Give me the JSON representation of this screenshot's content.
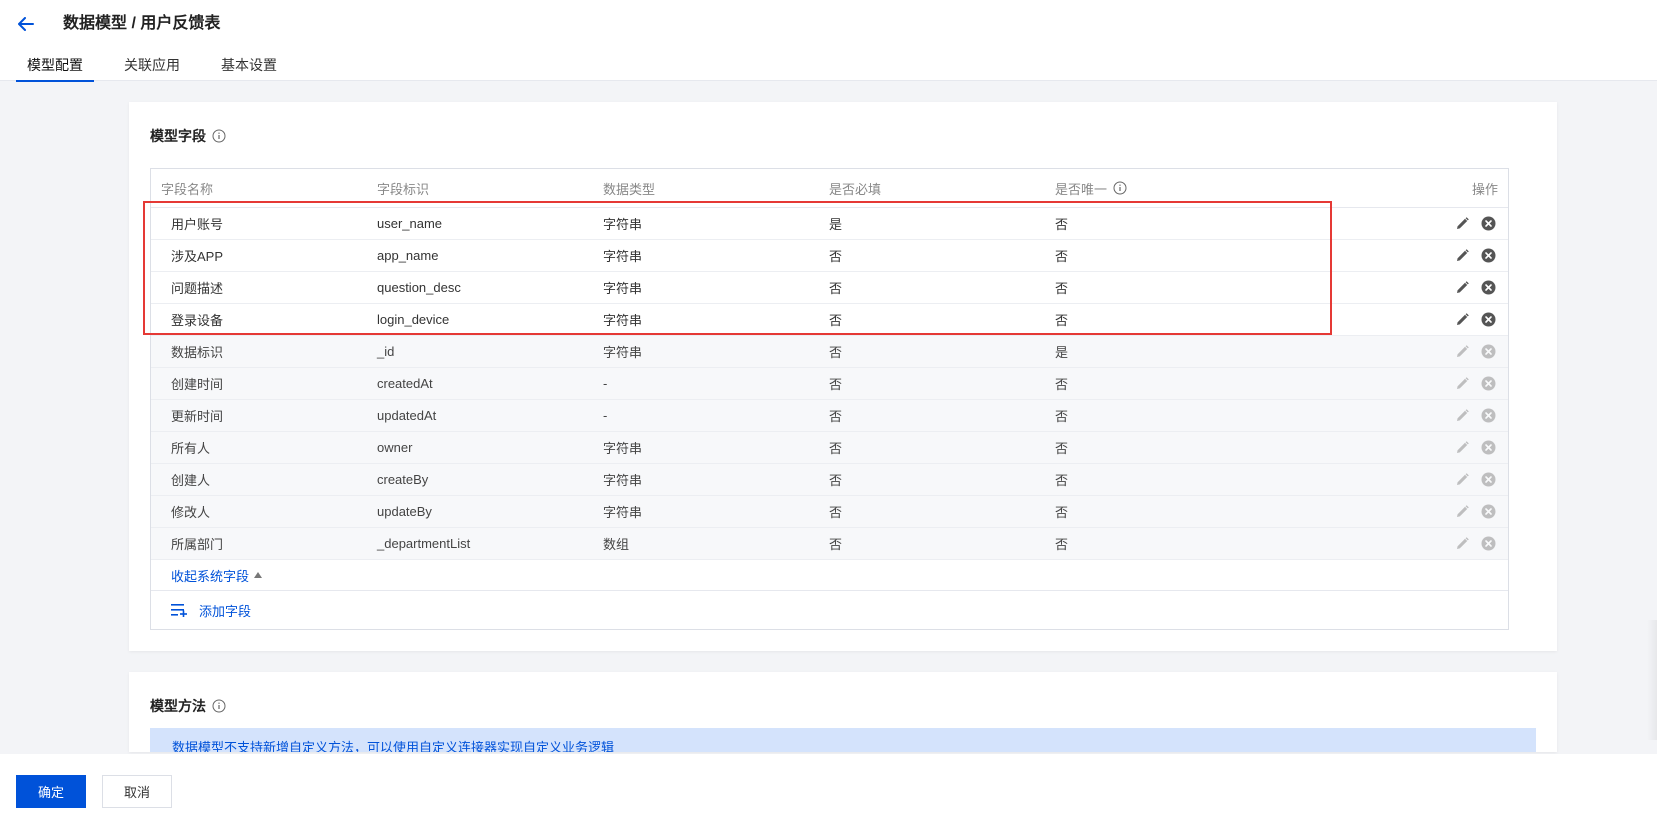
{
  "header": {
    "title": "数据模型 / 用户反馈表",
    "tabs": [
      {
        "label": "模型配置",
        "active": true
      },
      {
        "label": "关联应用",
        "active": false
      },
      {
        "label": "基本设置",
        "active": false
      }
    ]
  },
  "fields_card": {
    "title": "模型字段",
    "columns": [
      "字段名称",
      "字段标识",
      "数据类型",
      "是否必填",
      "是否唯一",
      "操作"
    ],
    "rows": [
      {
        "name": "用户账号",
        "key": "user_name",
        "type": "字符串",
        "required": "是",
        "unique": "否",
        "system": false
      },
      {
        "name": "涉及APP",
        "key": "app_name",
        "type": "字符串",
        "required": "否",
        "unique": "否",
        "system": false
      },
      {
        "name": "问题描述",
        "key": "question_desc",
        "type": "字符串",
        "required": "否",
        "unique": "否",
        "system": false
      },
      {
        "name": "登录设备",
        "key": "login_device",
        "type": "字符串",
        "required": "否",
        "unique": "否",
        "system": false
      },
      {
        "name": "数据标识",
        "key": "_id",
        "type": "字符串",
        "required": "否",
        "unique": "是",
        "system": true
      },
      {
        "name": "创建时间",
        "key": "createdAt",
        "type": "-",
        "required": "否",
        "unique": "否",
        "system": true
      },
      {
        "name": "更新时间",
        "key": "updatedAt",
        "type": "-",
        "required": "否",
        "unique": "否",
        "system": true
      },
      {
        "name": "所有人",
        "key": "owner",
        "type": "字符串",
        "required": "否",
        "unique": "否",
        "system": true
      },
      {
        "name": "创建人",
        "key": "createBy",
        "type": "字符串",
        "required": "否",
        "unique": "否",
        "system": true
      },
      {
        "name": "修改人",
        "key": "updateBy",
        "type": "字符串",
        "required": "否",
        "unique": "否",
        "system": true
      },
      {
        "name": "所属部门",
        "key": "_departmentList",
        "type": "数组",
        "required": "否",
        "unique": "否",
        "system": true
      }
    ],
    "collapse_label": "收起系统字段",
    "add_label": "添加字段"
  },
  "methods_card": {
    "title": "模型方法",
    "notice": "数据模型不支持新增自定义方法，可以使用自定义连接器实现自定义业务逻辑"
  },
  "footer": {
    "confirm_label": "确定",
    "cancel_label": "取消"
  },
  "colors": {
    "primary": "#0052d9",
    "highlight": "#e53935"
  }
}
